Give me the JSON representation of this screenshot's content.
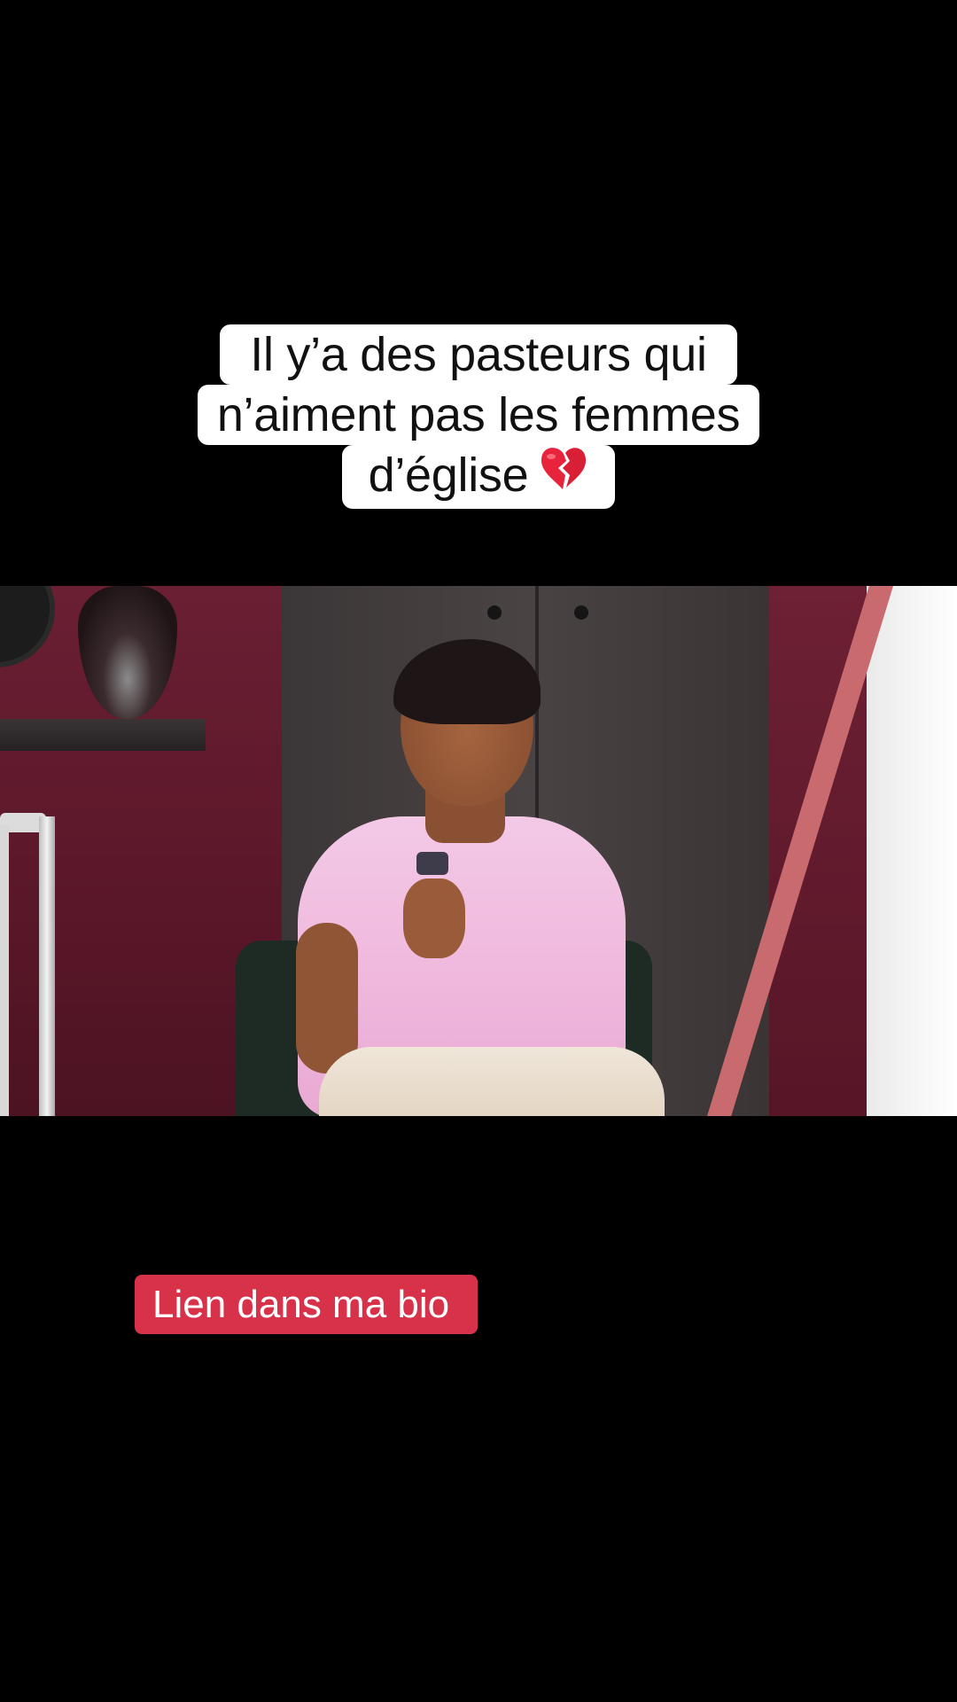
{
  "caption": {
    "lines": [
      "Il y’a des pasteurs qui",
      "n’aiment pas les femmes",
      "d’église"
    ],
    "emoji_icon": "broken-heart-icon"
  },
  "cta": {
    "label": "Lien dans ma bio"
  },
  "colors": {
    "background": "#000000",
    "caption_bg": "#ffffff",
    "caption_text": "#111111",
    "cta_bg": "#d8324a",
    "cta_text": "#ffffff",
    "emoji_red": "#e8243c"
  }
}
